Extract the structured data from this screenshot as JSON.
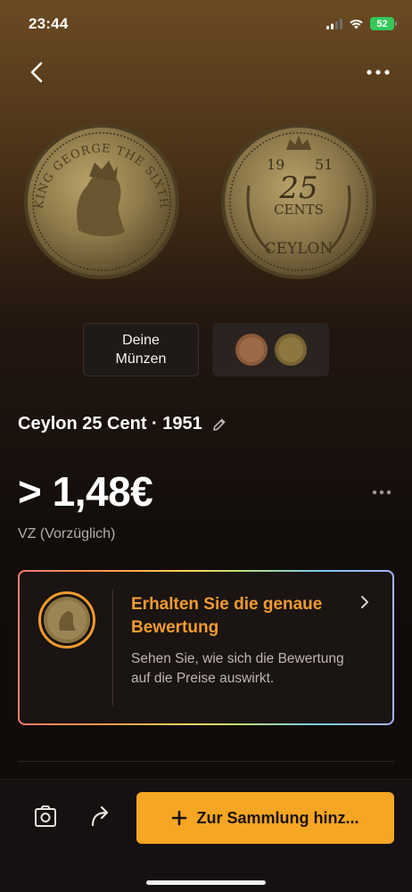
{
  "status_bar": {
    "time": "23:44",
    "battery": "52"
  },
  "nav": {
    "back_icon": "chevron-left-icon",
    "more_icon": "more-horizontal-icon"
  },
  "coin_images": {
    "obverse": {
      "inscription": "KING GEORGE THE SIXTH"
    },
    "reverse": {
      "year_left": "19",
      "year_right": "51",
      "value": "25",
      "unit": "CENTS",
      "country": "CEYLON"
    }
  },
  "tabs": {
    "my_coins": "Deine\nMünzen"
  },
  "coin": {
    "title": "Ceylon 25 Cent · 1951",
    "price": "> 1,48€",
    "grade": "VZ (Vorzüglich)"
  },
  "promo": {
    "title": "Erhalten Sie die genaue Bewertung",
    "text": "Sehen Sie, wie sich die Bewertung auf die Preise auswirkt."
  },
  "bottom": {
    "add_button": "Zur Sammlung hinz..."
  },
  "colors": {
    "accent": "#f5a623",
    "promo_title": "#f39b2f",
    "battery": "#34c759"
  }
}
